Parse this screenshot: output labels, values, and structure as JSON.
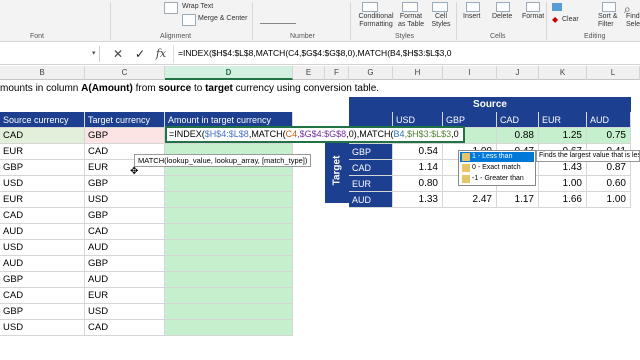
{
  "ribbon": {
    "wrap_text": "Wrap Text",
    "merge_center": "Merge & Center",
    "conditional_formatting": "Conditional Formatting",
    "format_as_table": "Format as Table",
    "cell_styles": "Cell Styles",
    "insert": "Insert",
    "delete": "Delete",
    "format": "Format",
    "clear": "Clear",
    "sort_filter": "Sort & Filter",
    "find_select": "Find & Select",
    "groups": {
      "font": "Font",
      "alignment": "Alignment",
      "number": "Number",
      "styles": "Styles",
      "cells": "Cells",
      "editing": "Editing"
    }
  },
  "formula_bar": {
    "cancel": "✕",
    "enter": "✓",
    "fx": "fx",
    "formula": "=INDEX($H$4:$L$8,MATCH(C4,$G$4:$G$8,0),MATCH(B4,$H$3:$L$3,0"
  },
  "columns": [
    "B",
    "C",
    "D",
    "E",
    "F",
    "G",
    "H",
    "I",
    "J",
    "K",
    "L"
  ],
  "instruction": {
    "prefix": "mounts in column ",
    "col": "A(Amount)",
    "mid1": " from ",
    "source": "source",
    "mid2": " to ",
    "target": "target",
    "suffix": " currency using conversion table."
  },
  "table": {
    "headers": [
      "Source currency",
      "Target currency",
      "Amount in target currency"
    ],
    "rows": [
      [
        "CAD",
        "GBP"
      ],
      [
        "EUR",
        "CAD"
      ],
      [
        "GBP",
        "EUR"
      ],
      [
        "USD",
        "GBP"
      ],
      [
        "EUR",
        "USD"
      ],
      [
        "CAD",
        "GBP"
      ],
      [
        "AUD",
        "CAD"
      ],
      [
        "USD",
        "AUD"
      ],
      [
        "AUD",
        "GBP"
      ],
      [
        "GBP",
        "AUD"
      ],
      [
        "CAD",
        "EUR"
      ],
      [
        "GBP",
        "USD"
      ],
      [
        "USD",
        "CAD"
      ]
    ]
  },
  "active_cell_formula": {
    "a": "=INDEX(",
    "b": "$H$4:$L$8",
    "c": ",MATCH(",
    "d": "C4",
    "e": ",$G$4:$G$8",
    "f": ",0)",
    "g": ",MATCH(",
    "h": "B4",
    "i": ",$H$3:$L$3",
    "j": ",0"
  },
  "tooltip_syntax": "MATCH(lookup_value, lookup_array, [match_type])",
  "conversion": {
    "source_label": "Source",
    "target_label": "Target",
    "source_currencies": [
      "USD",
      "GBP",
      "CAD",
      "EUR",
      "AUD"
    ],
    "rows": [
      {
        "cur": "",
        "vals": [
          "",
          "",
          "0.88",
          "1.25",
          "0.75"
        ]
      },
      {
        "cur": "GBP",
        "vals": [
          "0.54",
          "1.00",
          "0.47",
          "0.67",
          "0.41"
        ]
      },
      {
        "cur": "CAD",
        "vals": [
          "1.14",
          "",
          "",
          "1.43",
          "0.87"
        ]
      },
      {
        "cur": "EUR",
        "vals": [
          "0.80",
          "",
          "",
          "1.00",
          "0.60"
        ]
      },
      {
        "cur": "AUD",
        "vals": [
          "1.33",
          "2.47",
          "1.17",
          "1.66",
          "1.00"
        ]
      }
    ]
  },
  "autocomplete": {
    "items": [
      "1 - Less than",
      "0 - Exact match",
      "-1 - Greater than"
    ],
    "tip": "Finds the largest value that is les"
  }
}
